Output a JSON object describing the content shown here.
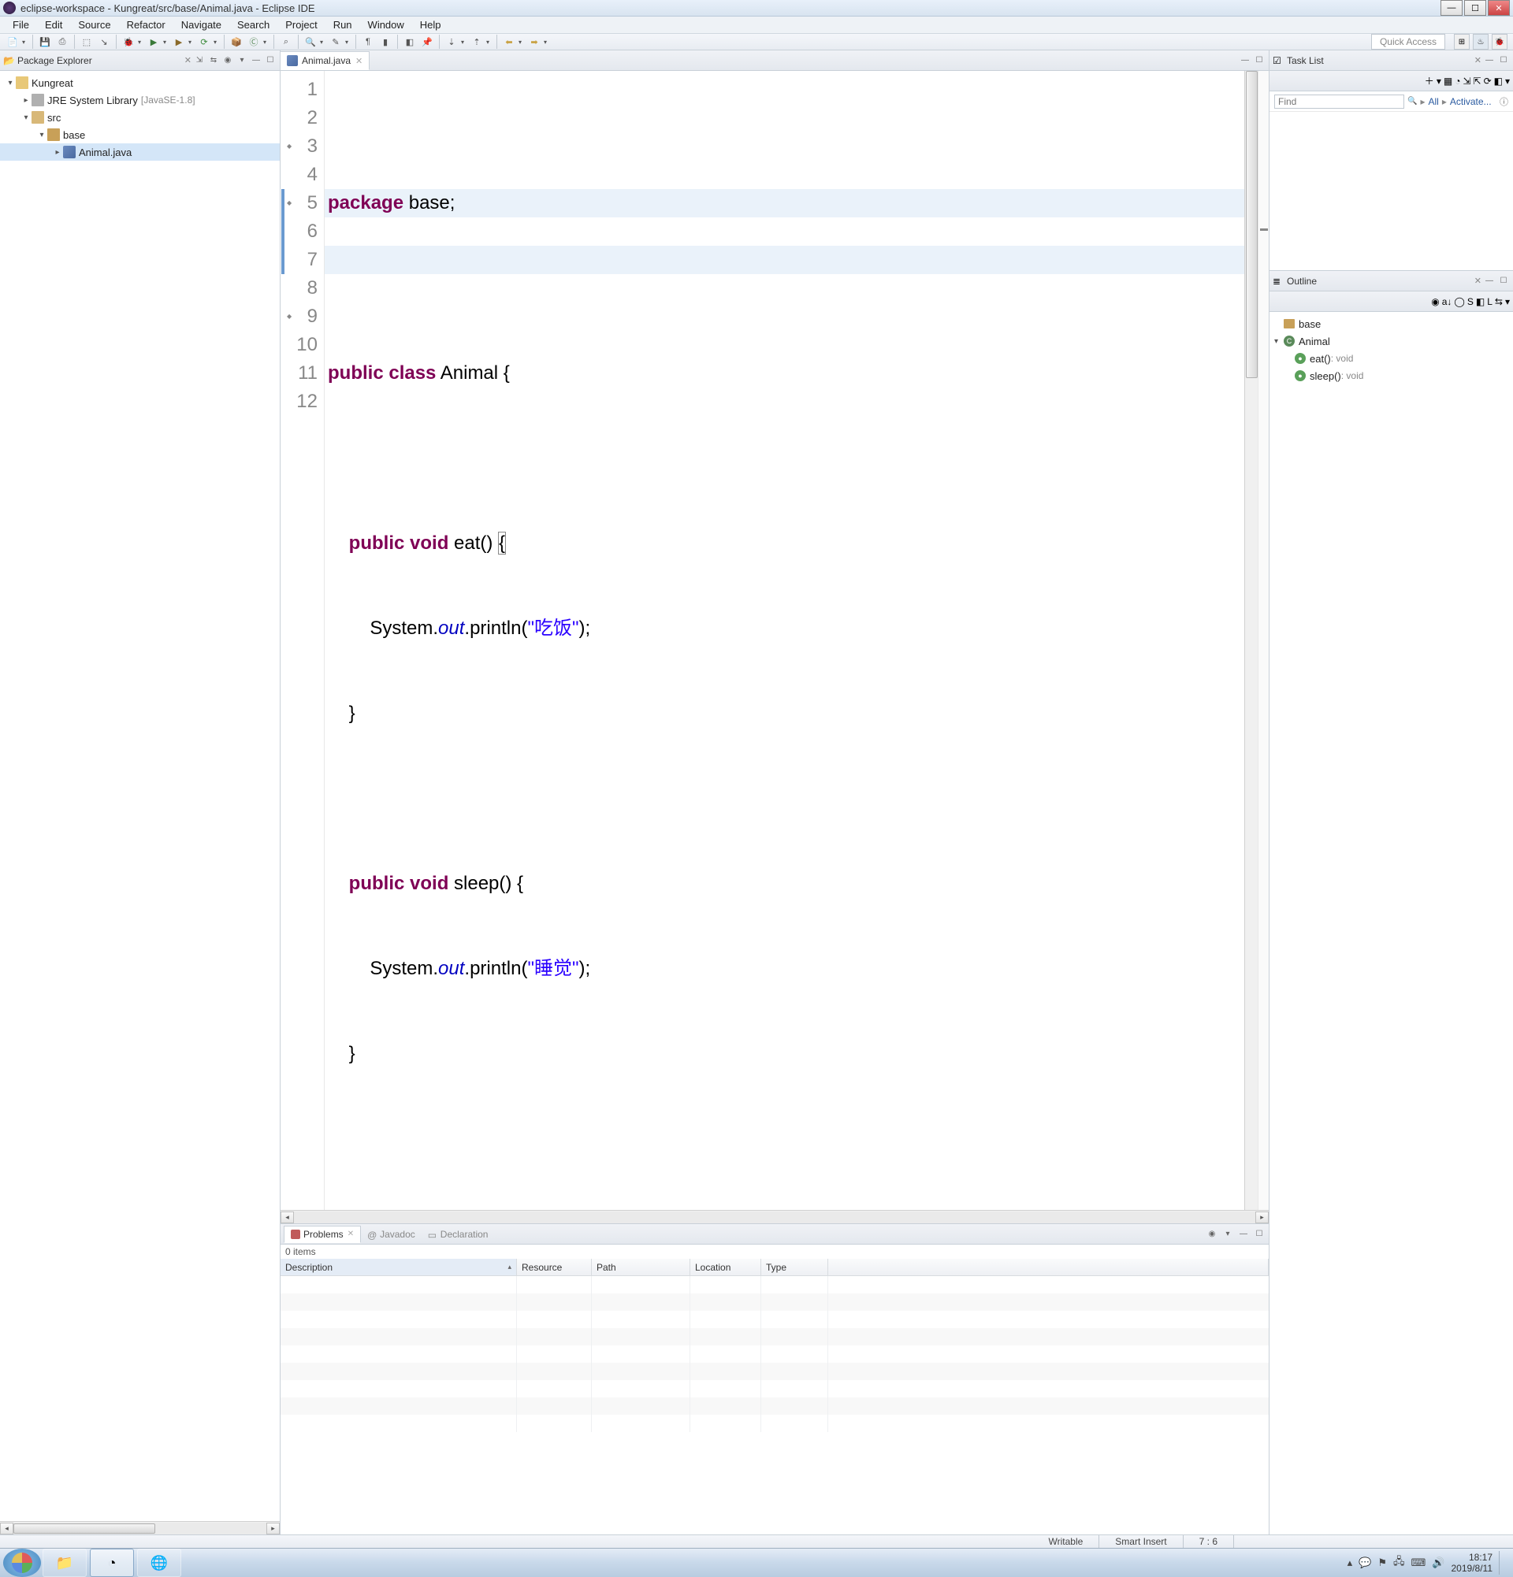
{
  "window": {
    "title": "eclipse-workspace - Kungreat/src/base/Animal.java - Eclipse IDE"
  },
  "menu": [
    "File",
    "Edit",
    "Source",
    "Refactor",
    "Navigate",
    "Search",
    "Project",
    "Run",
    "Window",
    "Help"
  ],
  "quick_access": "Quick Access",
  "package_explorer": {
    "title": "Package Explorer",
    "project": "Kungreat",
    "jre": "JRE System Library",
    "jre_tag": "[JavaSE-1.8]",
    "src": "src",
    "pkg": "base",
    "file": "Animal.java"
  },
  "editor": {
    "tab": "Animal.java",
    "lines": [
      "1",
      "2",
      "3",
      "4",
      "5",
      "6",
      "7",
      "8",
      "9",
      "10",
      "11",
      "12"
    ],
    "code": {
      "l1_kw1": "package",
      "l1_id": " base;",
      "l3_kw1": "public",
      "l3_kw2": "class",
      "l3_id": " Animal {",
      "l5_kw1": "public",
      "l5_kw2": "void",
      "l5_id": " eat() ",
      "l5_br": "{",
      "l6_pre": "        System.",
      "l6_out": "out",
      "l6_mid": ".println(",
      "l6_str": "\"吃饭\"",
      "l6_end": ");",
      "l7": "    }",
      "l9_kw1": "public",
      "l9_kw2": "void",
      "l9_id": " sleep() {",
      "l10_pre": "        System.",
      "l10_out": "out",
      "l10_mid": ".println(",
      "l10_str": "\"睡觉\"",
      "l10_end": ");",
      "l11": "    }"
    }
  },
  "task_list": {
    "title": "Task List",
    "find_placeholder": "Find",
    "all": "All",
    "activate": "Activate..."
  },
  "outline": {
    "title": "Outline",
    "pkg": "base",
    "class": "Animal",
    "m1": "eat()",
    "m1r": " : void",
    "m2": "sleep()",
    "m2r": " : void"
  },
  "problems": {
    "tab1": "Problems",
    "tab2": "Javadoc",
    "tab3": "Declaration",
    "items": "0 items",
    "cols": {
      "desc": "Description",
      "res": "Resource",
      "path": "Path",
      "loc": "Location",
      "type": "Type"
    }
  },
  "status": {
    "writable": "Writable",
    "insert": "Smart Insert",
    "pos": "7 : 6"
  },
  "systray": {
    "time": "18:17",
    "date": "2019/8/11"
  }
}
